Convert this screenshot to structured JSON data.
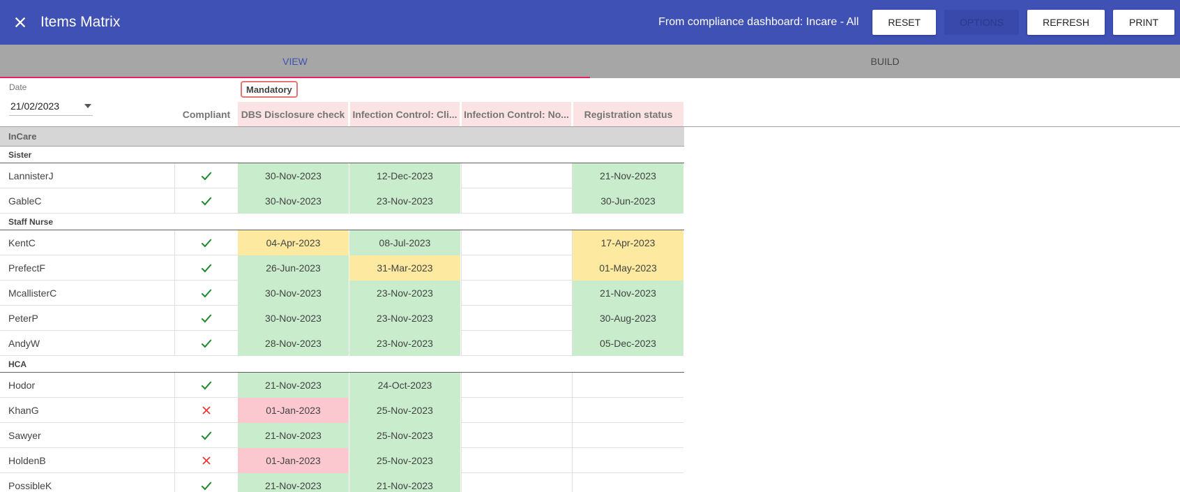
{
  "app": {
    "title": "Items Matrix",
    "context": "From compliance dashboard: Incare - All",
    "buttons": {
      "reset": "RESET",
      "options": "OPTIONS",
      "refresh": "REFRESH",
      "print": "PRINT"
    },
    "accent": "#3f51b5",
    "tab_indicator": "#e91e63"
  },
  "tabs": [
    {
      "label": "VIEW",
      "active": true
    },
    {
      "label": "BUILD",
      "active": false
    }
  ],
  "date": {
    "label": "Date",
    "value": "21/02/2023"
  },
  "matrix": {
    "group_label": "Mandatory",
    "compliant_header": "Compliant",
    "columns": [
      "DBS Disclosure check",
      "Infection Control: Cli...",
      "Infection Control: No...",
      "Registration status"
    ],
    "status_colors": {
      "green": "#c8eccc",
      "yellow": "#fdeaa0",
      "red": "#fbc8d0",
      "header": "#fbe3e3"
    },
    "section": "InCare",
    "groups": [
      {
        "name": "Sister",
        "rows": [
          {
            "name": "LannisterJ",
            "compliant": true,
            "cells": [
              {
                "v": "30-Nov-2023",
                "s": "green"
              },
              {
                "v": "12-Dec-2023",
                "s": "green"
              },
              {
                "v": "",
                "s": ""
              },
              {
                "v": "21-Nov-2023",
                "s": "green"
              }
            ]
          },
          {
            "name": "GableC",
            "compliant": true,
            "cells": [
              {
                "v": "30-Nov-2023",
                "s": "green"
              },
              {
                "v": "23-Nov-2023",
                "s": "green"
              },
              {
                "v": "",
                "s": ""
              },
              {
                "v": "30-Jun-2023",
                "s": "green"
              }
            ]
          }
        ]
      },
      {
        "name": "Staff Nurse",
        "rows": [
          {
            "name": "KentC",
            "compliant": true,
            "cells": [
              {
                "v": "04-Apr-2023",
                "s": "yellow"
              },
              {
                "v": "08-Jul-2023",
                "s": "green"
              },
              {
                "v": "",
                "s": ""
              },
              {
                "v": "17-Apr-2023",
                "s": "yellow"
              }
            ]
          },
          {
            "name": "PrefectF",
            "compliant": true,
            "cells": [
              {
                "v": "26-Jun-2023",
                "s": "green"
              },
              {
                "v": "31-Mar-2023",
                "s": "yellow"
              },
              {
                "v": "",
                "s": ""
              },
              {
                "v": "01-May-2023",
                "s": "yellow"
              }
            ]
          },
          {
            "name": "McallisterC",
            "compliant": true,
            "cells": [
              {
                "v": "30-Nov-2023",
                "s": "green"
              },
              {
                "v": "23-Nov-2023",
                "s": "green"
              },
              {
                "v": "",
                "s": ""
              },
              {
                "v": "21-Nov-2023",
                "s": "green"
              }
            ]
          },
          {
            "name": "PeterP",
            "compliant": true,
            "cells": [
              {
                "v": "30-Nov-2023",
                "s": "green"
              },
              {
                "v": "23-Nov-2023",
                "s": "green"
              },
              {
                "v": "",
                "s": ""
              },
              {
                "v": "30-Aug-2023",
                "s": "green"
              }
            ]
          },
          {
            "name": "AndyW",
            "compliant": true,
            "cells": [
              {
                "v": "28-Nov-2023",
                "s": "green"
              },
              {
                "v": "23-Nov-2023",
                "s": "green"
              },
              {
                "v": "",
                "s": ""
              },
              {
                "v": "05-Dec-2023",
                "s": "green"
              }
            ]
          }
        ]
      },
      {
        "name": "HCA",
        "rows": [
          {
            "name": "Hodor",
            "compliant": true,
            "cells": [
              {
                "v": "21-Nov-2023",
                "s": "green"
              },
              {
                "v": "24-Oct-2023",
                "s": "green"
              },
              {
                "v": "",
                "s": ""
              },
              {
                "v": "",
                "s": ""
              }
            ]
          },
          {
            "name": "KhanG",
            "compliant": false,
            "cells": [
              {
                "v": "01-Jan-2023",
                "s": "red"
              },
              {
                "v": "25-Nov-2023",
                "s": "green"
              },
              {
                "v": "",
                "s": ""
              },
              {
                "v": "",
                "s": ""
              }
            ]
          },
          {
            "name": "Sawyer",
            "compliant": true,
            "cells": [
              {
                "v": "21-Nov-2023",
                "s": "green"
              },
              {
                "v": "25-Nov-2023",
                "s": "green"
              },
              {
                "v": "",
                "s": ""
              },
              {
                "v": "",
                "s": ""
              }
            ]
          },
          {
            "name": "HoldenB",
            "compliant": false,
            "cells": [
              {
                "v": "01-Jan-2023",
                "s": "red"
              },
              {
                "v": "25-Nov-2023",
                "s": "green"
              },
              {
                "v": "",
                "s": ""
              },
              {
                "v": "",
                "s": ""
              }
            ]
          },
          {
            "name": "PossibleK",
            "compliant": true,
            "cells": [
              {
                "v": "21-Nov-2023",
                "s": "green"
              },
              {
                "v": "21-Nov-2023",
                "s": "green"
              },
              {
                "v": "",
                "s": ""
              },
              {
                "v": "",
                "s": ""
              }
            ]
          }
        ]
      }
    ]
  }
}
